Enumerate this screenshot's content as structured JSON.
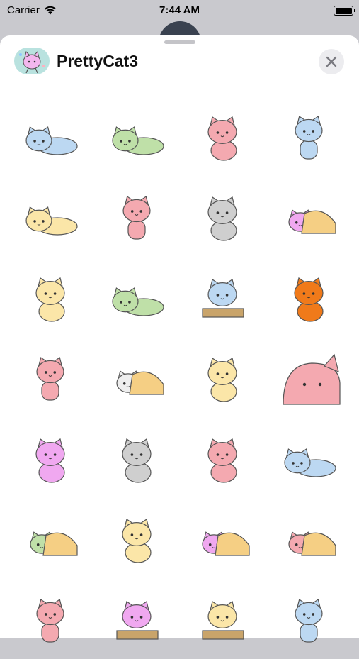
{
  "status": {
    "carrier": "Carrier",
    "time": "7:44 AM"
  },
  "pack": {
    "title": "PrettyCat3"
  },
  "colors": {
    "sheet": "#ffffff",
    "blue": "#bcd8f2",
    "green": "#bfe0a8",
    "pink": "#f4a9b0",
    "cream": "#fbe6a8",
    "gray": "#cfcfcf",
    "purple": "#f0a8f0",
    "orange": "#f07a1a"
  },
  "stickers": [
    {
      "name": "blue-cat-lying",
      "color": "#bcd8f2",
      "pose": "lie"
    },
    {
      "name": "green-cat-lying",
      "color": "#bfe0a8",
      "pose": "lie"
    },
    {
      "name": "pink-cat-sitting",
      "color": "#f4a9b0",
      "pose": "sit"
    },
    {
      "name": "blue-cat-standing",
      "color": "#bcd8f2",
      "pose": "stand"
    },
    {
      "name": "cream-cat-lying",
      "color": "#fbe6a8",
      "pose": "lie"
    },
    {
      "name": "pink-cat-walking",
      "color": "#f4a9b0",
      "pose": "stand"
    },
    {
      "name": "gray-cat-sitting",
      "color": "#cfcfcf",
      "pose": "sit"
    },
    {
      "name": "purple-cat-blanket",
      "color": "#f0a8f0",
      "pose": "blanket"
    },
    {
      "name": "cream-cat-sitting",
      "color": "#fbe6a8",
      "pose": "sit"
    },
    {
      "name": "green-cat-flat",
      "color": "#bfe0a8",
      "pose": "lie"
    },
    {
      "name": "blue-cat-desk",
      "color": "#bcd8f2",
      "pose": "desk"
    },
    {
      "name": "orange-cat-party",
      "color": "#f07a1a",
      "pose": "sit"
    },
    {
      "name": "pink-cat-standing",
      "color": "#f4a9b0",
      "pose": "stand"
    },
    {
      "name": "white-cat-sleeping",
      "color": "#eeeeee",
      "pose": "blanket"
    },
    {
      "name": "cream-cat-shocked",
      "color": "#fbe6a8",
      "pose": "sit"
    },
    {
      "name": "pink-cat-big-face",
      "color": "#f4a9b0",
      "pose": "face"
    },
    {
      "name": "purple-cat-gaming",
      "color": "#f0a8f0",
      "pose": "sit"
    },
    {
      "name": "gray-cat-gift",
      "color": "#cfcfcf",
      "pose": "sit"
    },
    {
      "name": "pink-cat-corner",
      "color": "#f4a9b0",
      "pose": "sit"
    },
    {
      "name": "blue-cat-laptop",
      "color": "#bcd8f2",
      "pose": "lie"
    },
    {
      "name": "green-cat-box",
      "color": "#bfe0a8",
      "pose": "blanket"
    },
    {
      "name": "cream-cat-phone",
      "color": "#fbe6a8",
      "pose": "sit"
    },
    {
      "name": "purple-cat-night",
      "color": "#f0a8f0",
      "pose": "blanket"
    },
    {
      "name": "pink-cat-morning",
      "color": "#f4a9b0",
      "pose": "blanket"
    },
    {
      "name": "pink-cat-dancing",
      "color": "#f4a9b0",
      "pose": "stand"
    },
    {
      "name": "purple-cat-table",
      "color": "#f0a8f0",
      "pose": "desk"
    },
    {
      "name": "cream-cat-cooking",
      "color": "#fbe6a8",
      "pose": "desk"
    },
    {
      "name": "blue-cat-laundry",
      "color": "#bcd8f2",
      "pose": "stand"
    }
  ]
}
